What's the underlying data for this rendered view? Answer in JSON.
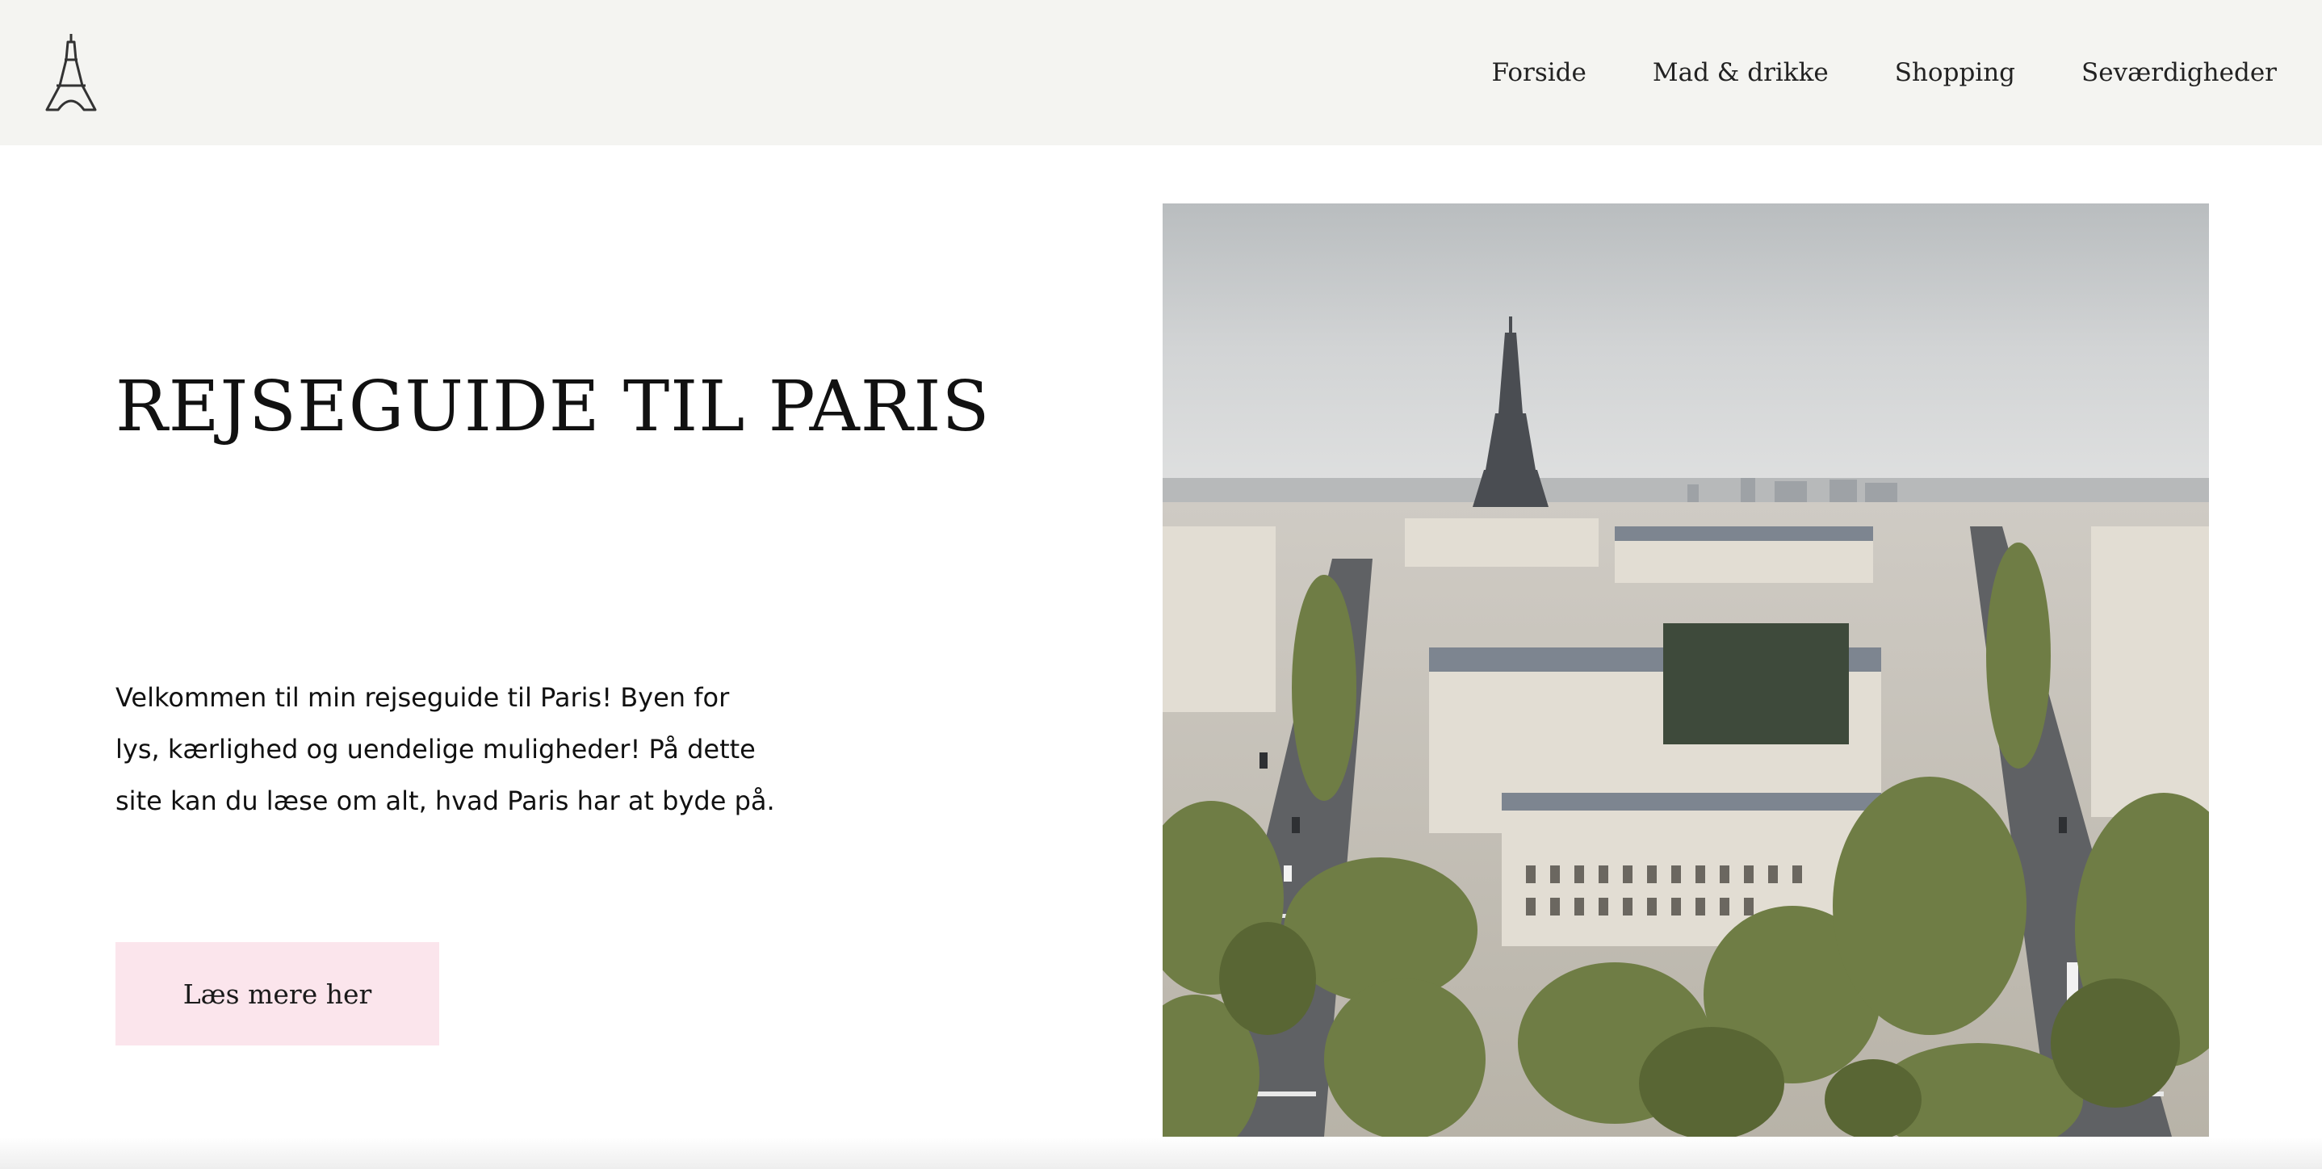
{
  "header": {
    "logo_icon": "eiffel-tower-icon",
    "nav": [
      {
        "label": "Forside"
      },
      {
        "label": "Mad & drikke"
      },
      {
        "label": "Shopping"
      },
      {
        "label": "Seværdigheder"
      }
    ]
  },
  "hero": {
    "title": "REJSEGUIDE TIL PARIS",
    "text": "Velkommen til min rejseguide til Paris! Byen for lys, kærlighed og uendelige muligheder! På dette site kan du læse om alt, hvad Paris har at byde på.",
    "cta_label": "Læs mere her",
    "image_icon": "paris-photo"
  },
  "colors": {
    "header_bg": "#f4f4f1",
    "cta_bg": "#fbe5ec",
    "text": "#111111"
  }
}
